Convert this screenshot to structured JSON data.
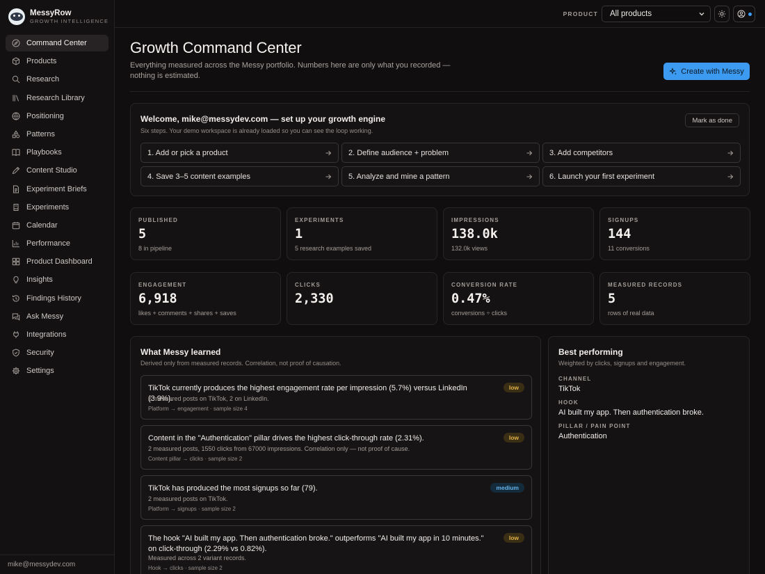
{
  "brand": {
    "name": "MessyRow",
    "tagline": "GROWTH INTELLIGENCE"
  },
  "nav": [
    {
      "label": "Command Center",
      "icon": "compass-icon",
      "active": true
    },
    {
      "label": "Products",
      "icon": "box-icon"
    },
    {
      "label": "Research",
      "icon": "search-icon"
    },
    {
      "label": "Research Library",
      "icon": "library-icon"
    },
    {
      "label": "Positioning",
      "icon": "target-icon"
    },
    {
      "label": "Patterns",
      "icon": "shapes-icon"
    },
    {
      "label": "Playbooks",
      "icon": "book-icon"
    },
    {
      "label": "Content Studio",
      "icon": "pen-icon"
    },
    {
      "label": "Experiment Briefs",
      "icon": "file-icon"
    },
    {
      "label": "Experiments",
      "icon": "flask-icon"
    },
    {
      "label": "Calendar",
      "icon": "calendar-icon"
    },
    {
      "label": "Performance",
      "icon": "bar-chart-icon"
    },
    {
      "label": "Product Dashboard",
      "icon": "dashboard-icon"
    },
    {
      "label": "Insights",
      "icon": "lightbulb-icon"
    },
    {
      "label": "Findings History",
      "icon": "history-icon"
    },
    {
      "label": "Ask Messy",
      "icon": "chat-icon"
    },
    {
      "label": "Integrations",
      "icon": "plug-icon"
    },
    {
      "label": "Security",
      "icon": "shield-icon"
    },
    {
      "label": "Settings",
      "icon": "gear-icon"
    }
  ],
  "user_email": "mike@messydev.com",
  "topbar": {
    "product_label": "PRODUCT",
    "product_value": "All products"
  },
  "header": {
    "title": "Growth Command Center",
    "subtitle": "Everything measured across the Messy portfolio. Numbers here are only what you recorded — nothing is estimated.",
    "create_button": "Create with Messy"
  },
  "welcome": {
    "title": "Welcome, mike@messydev.com — set up your growth engine",
    "subtitle": "Six steps. Your demo workspace is already loaded so you can see the loop working.",
    "mark_done": "Mark as done",
    "steps": [
      "1. Add or pick a product",
      "2. Define audience + problem",
      "3. Add competitors",
      "4. Save 3–5 content examples",
      "5. Analyze and mine a pattern",
      "6. Launch your first experiment"
    ]
  },
  "stats": [
    {
      "label": "PUBLISHED",
      "value": "5",
      "note": "8 in pipeline"
    },
    {
      "label": "EXPERIMENTS",
      "value": "1",
      "note": "5 research examples saved"
    },
    {
      "label": "IMPRESSIONS",
      "value": "138.0k",
      "note": "132.0k views"
    },
    {
      "label": "SIGNUPS",
      "value": "144",
      "note": "11 conversions"
    },
    {
      "label": "ENGAGEMENT",
      "value": "6,918",
      "note": "likes + comments + shares + saves"
    },
    {
      "label": "CLICKS",
      "value": "2,330",
      "note": ""
    },
    {
      "label": "CONVERSION RATE",
      "value": "0.47%",
      "note": "conversions ÷ clicks"
    },
    {
      "label": "MEASURED RECORDS",
      "value": "5",
      "note": "rows of real data"
    }
  ],
  "learned": {
    "title": "What Messy learned",
    "subtitle": "Derived only from measured records. Correlation, not proof of causation.",
    "findings": [
      {
        "title": "TikTok currently produces the highest engagement rate per impression (5.7%) versus LinkedIn (3.9%).",
        "detail": "2 measured posts on TikTok, 2 on LinkedIn.",
        "meta": "Platform → engagement · sample size 4",
        "confidence": "low"
      },
      {
        "title": "Content in the \"Authentication\" pillar drives the highest click-through rate (2.31%).",
        "detail": "2 measured posts, 1550 clicks from 67000 impressions. Correlation only — not proof of cause.",
        "meta": "Content pillar → clicks · sample size 2",
        "confidence": "low"
      },
      {
        "title": "TikTok has produced the most signups so far (79).",
        "detail": "2 measured posts on TikTok.",
        "meta": "Platform → signups · sample size 2",
        "confidence": "medium"
      },
      {
        "title": "The hook \"AI built my app. Then authentication broke.\" outperforms \"AI built my app in 10 minutes.\" on click-through (2.29% vs 0.82%).",
        "detail": "Measured across 2 variant records.",
        "meta": "Hook → clicks · sample size 2",
        "confidence": "low"
      }
    ]
  },
  "best": {
    "title": "Best performing",
    "subtitle": "Weighted by clicks, signups and engagement.",
    "channel_label": "CHANNEL",
    "channel_value": "TikTok",
    "hook_label": "HOOK",
    "hook_value": "AI built my app. Then authentication broke.",
    "pillar_label": "PILLAR / PAIN POINT",
    "pillar_value": "Authentication"
  },
  "colors": {
    "accent": "#3c9bf0",
    "background": "#100e0e",
    "low_badge": "#e0b349",
    "medium_badge": "#65b2e8"
  }
}
